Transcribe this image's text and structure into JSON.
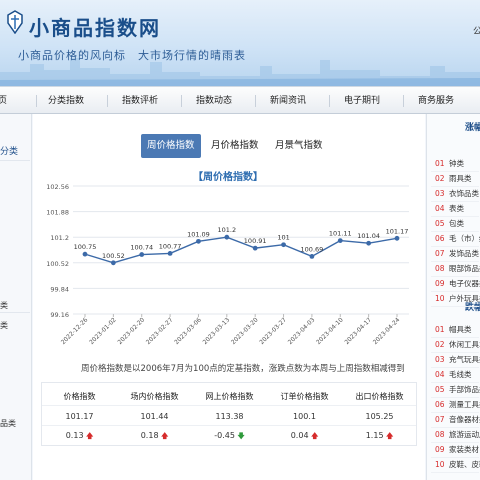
{
  "header": {
    "site_title": "小商品指数网",
    "slogan": "小商品价格的风向标　大市场行情的晴雨表",
    "corner_text": "公"
  },
  "nav": {
    "items": [
      "页",
      "分类指数",
      "指数评析",
      "指数动态",
      "新闻资讯",
      "电子期刊",
      "商务服务"
    ]
  },
  "left_sidebar": {
    "heading": "分类",
    "fragments": [
      "类",
      "类",
      "品类"
    ]
  },
  "tabs": [
    {
      "label": "周价格指数",
      "active": true
    },
    {
      "label": "月价格指数",
      "active": false
    },
    {
      "label": "月景气指数",
      "active": false
    }
  ],
  "chart_data": {
    "type": "line",
    "title": "【周价格指数】",
    "x": [
      "2022-12-26",
      "2023-01-02",
      "2023-02-20",
      "2023-02-27",
      "2023-03-06",
      "2023-03-13",
      "2023-03-20",
      "2023-03-27",
      "2023-04-03",
      "2023-04-10",
      "2023-04-17",
      "2023-04-24"
    ],
    "values": [
      100.75,
      100.52,
      100.74,
      100.77,
      101.09,
      101.2,
      100.91,
      101,
      100.69,
      101.11,
      101.04,
      101.17
    ],
    "value_labels": [
      "100.75",
      "100.52",
      "100.74",
      "100.77",
      "101.09",
      "101.2",
      "100.91",
      "101",
      "100.69",
      "101.11",
      "101.04",
      "101.17"
    ],
    "y_ticks": [
      "102.56",
      "101.88",
      "101.2",
      "100.52",
      "99.84",
      "99.16"
    ],
    "ylim": [
      99.16,
      102.56
    ],
    "grid": true,
    "line_color": "#3c6aa8"
  },
  "note": "周价格指数是以2006年7月为100点的定基指数，涨跌点数为本周与上周指数相减得到",
  "index_table": [
    {
      "header": "价格指数",
      "value": "101.17",
      "change": "0.13",
      "direction": "up"
    },
    {
      "header": "场内价格指数",
      "value": "101.44",
      "change": "0.18",
      "direction": "up"
    },
    {
      "header": "网上价格指数",
      "value": "113.38",
      "change": "-0.45",
      "direction": "down"
    },
    {
      "header": "订单价格指数",
      "value": "100.1",
      "change": "0.04",
      "direction": "up"
    },
    {
      "header": "出口价格指数",
      "value": "105.25",
      "change": "1.15",
      "direction": "up"
    }
  ],
  "right_sidebar": {
    "rise_heading": "涨幅",
    "rise_items": [
      {
        "num": "01",
        "label": "钟类"
      },
      {
        "num": "02",
        "label": "雨具类"
      },
      {
        "num": "03",
        "label": "衣饰品类"
      },
      {
        "num": "04",
        "label": "表类"
      },
      {
        "num": "05",
        "label": "包类"
      },
      {
        "num": "06",
        "label": "毛（市）纺"
      },
      {
        "num": "07",
        "label": "发饰品类"
      },
      {
        "num": "08",
        "label": "眼部饰品类"
      },
      {
        "num": "09",
        "label": "电子仪器类"
      },
      {
        "num": "10",
        "label": "户外玩具类"
      }
    ],
    "fall_heading": "跌幅",
    "fall_items": [
      {
        "num": "01",
        "label": "帽具类"
      },
      {
        "num": "02",
        "label": "休闲工具车"
      },
      {
        "num": "03",
        "label": "充气玩具类"
      },
      {
        "num": "04",
        "label": "毛线类"
      },
      {
        "num": "05",
        "label": "手部饰品类"
      },
      {
        "num": "06",
        "label": "测量工具类"
      },
      {
        "num": "07",
        "label": "音像器材类"
      },
      {
        "num": "08",
        "label": "旅游运动用"
      },
      {
        "num": "09",
        "label": "家装类材"
      },
      {
        "num": "10",
        "label": "皮鞋、皮靴"
      }
    ]
  }
}
